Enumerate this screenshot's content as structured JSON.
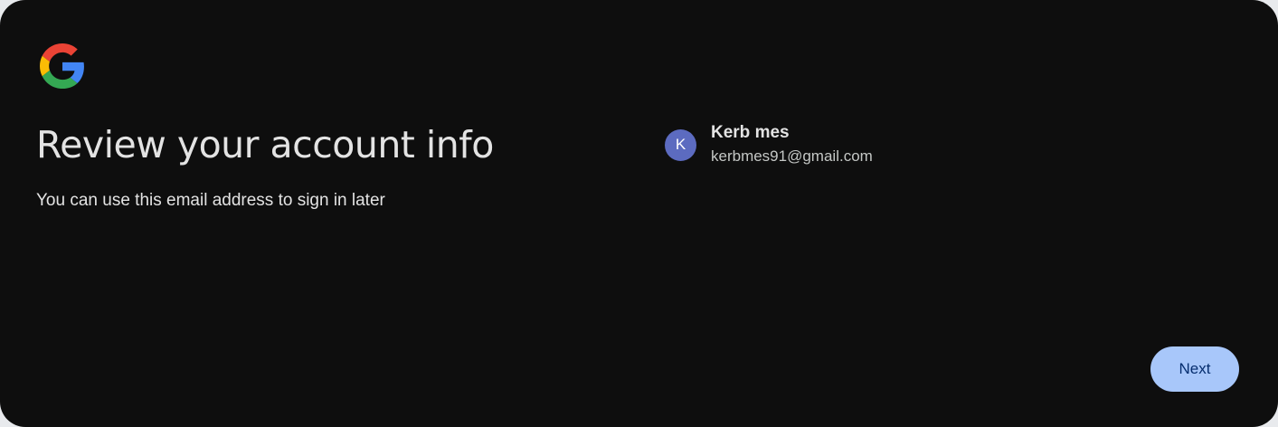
{
  "logo": {
    "icon": "google-g-icon",
    "colors": {
      "blue": "#4285F4",
      "red": "#EA4335",
      "yellow": "#FBBC05",
      "green": "#34A853"
    }
  },
  "page": {
    "title": "Review your account info",
    "subtitle": "You can use this email address to sign in later"
  },
  "account": {
    "avatar_initial": "K",
    "avatar_color": "#5c6bc0",
    "name": "Kerb mes",
    "email": "kerbmes91@gmail.com"
  },
  "actions": {
    "next_label": "Next",
    "accent_color": "#a8c7fa"
  }
}
